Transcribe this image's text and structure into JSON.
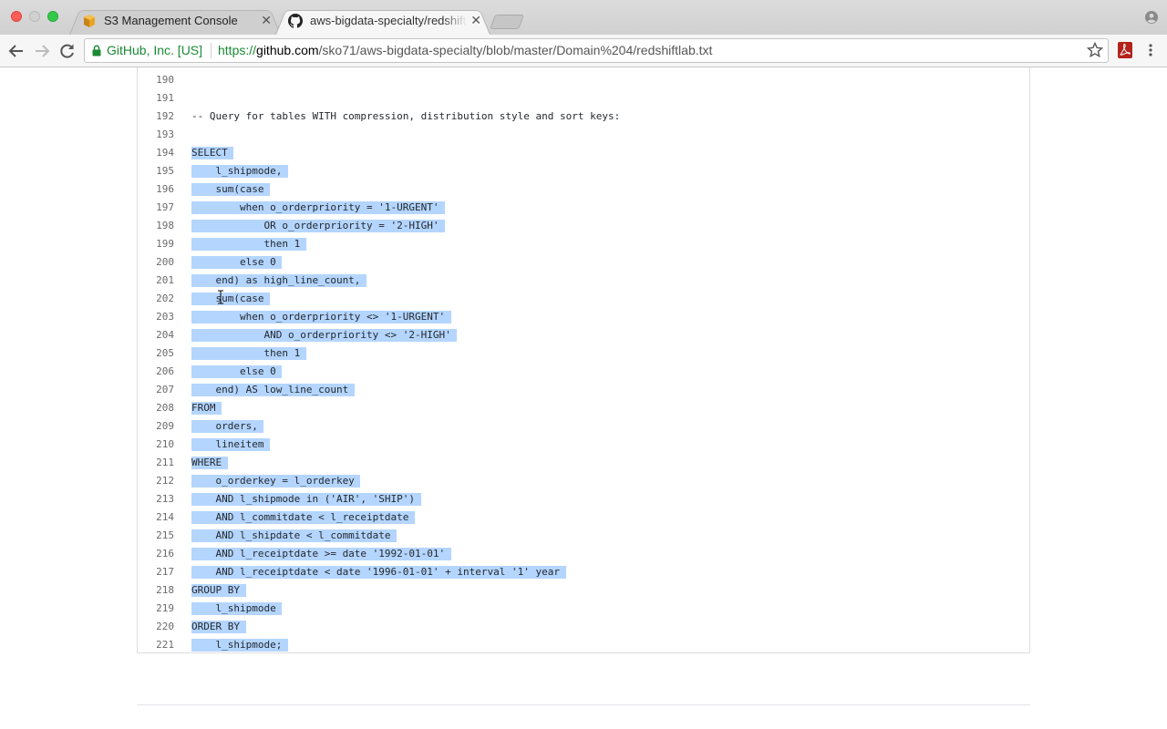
{
  "browser": {
    "tabs": [
      {
        "title": "S3 Management Console",
        "icon": "aws-s3-icon",
        "active": false
      },
      {
        "title": "aws-bigdata-specialty/redshiftlab.txt",
        "icon": "github-icon",
        "active": true
      }
    ],
    "address_bar": {
      "ev_label": "GitHub, Inc. [US]",
      "url_scheme": "https://",
      "url_host": "github.com",
      "url_path": "/sko71/aws-bigdata-specialty/blob/master/Domain%204/redshiftlab.txt"
    }
  },
  "code": {
    "lines": [
      {
        "num": "190",
        "text": "",
        "selected": false
      },
      {
        "num": "191",
        "text": "",
        "selected": false
      },
      {
        "num": "192",
        "text": "-- Query for tables WITH compression, distribution style and sort keys:",
        "selected": false
      },
      {
        "num": "193",
        "text": "",
        "selected": false
      },
      {
        "num": "194",
        "text": "SELECT ",
        "selected": true
      },
      {
        "num": "195",
        "text": "    l_shipmode, ",
        "selected": true
      },
      {
        "num": "196",
        "text": "    sum(case ",
        "selected": true
      },
      {
        "num": "197",
        "text": "        when o_orderpriority = '1-URGENT' ",
        "selected": true
      },
      {
        "num": "198",
        "text": "            OR o_orderpriority = '2-HIGH' ",
        "selected": true
      },
      {
        "num": "199",
        "text": "            then 1 ",
        "selected": true
      },
      {
        "num": "200",
        "text": "        else 0 ",
        "selected": true
      },
      {
        "num": "201",
        "text": "    end) as high_line_count, ",
        "selected": true
      },
      {
        "num": "202",
        "text": "    sum(case ",
        "selected": true
      },
      {
        "num": "203",
        "text": "        when o_orderpriority <> '1-URGENT' ",
        "selected": true
      },
      {
        "num": "204",
        "text": "            AND o_orderpriority <> '2-HIGH' ",
        "selected": true
      },
      {
        "num": "205",
        "text": "            then 1 ",
        "selected": true
      },
      {
        "num": "206",
        "text": "        else 0 ",
        "selected": true
      },
      {
        "num": "207",
        "text": "    end) AS low_line_count ",
        "selected": true
      },
      {
        "num": "208",
        "text": "FROM ",
        "selected": true
      },
      {
        "num": "209",
        "text": "    orders, ",
        "selected": true
      },
      {
        "num": "210",
        "text": "    lineitem ",
        "selected": true
      },
      {
        "num": "211",
        "text": "WHERE ",
        "selected": true
      },
      {
        "num": "212",
        "text": "    o_orderkey = l_orderkey ",
        "selected": true
      },
      {
        "num": "213",
        "text": "    AND l_shipmode in ('AIR', 'SHIP') ",
        "selected": true
      },
      {
        "num": "214",
        "text": "    AND l_commitdate < l_receiptdate ",
        "selected": true
      },
      {
        "num": "215",
        "text": "    AND l_shipdate < l_commitdate ",
        "selected": true
      },
      {
        "num": "216",
        "text": "    AND l_receiptdate >= date '1992-01-01' ",
        "selected": true
      },
      {
        "num": "217",
        "text": "    AND l_receiptdate < date '1996-01-01' + interval '1' year ",
        "selected": true
      },
      {
        "num": "218",
        "text": "GROUP BY ",
        "selected": true
      },
      {
        "num": "219",
        "text": "    l_shipmode ",
        "selected": true
      },
      {
        "num": "220",
        "text": "ORDER BY ",
        "selected": true
      },
      {
        "num": "221",
        "text": "    l_shipmode; ",
        "selected": true
      }
    ]
  },
  "colors": {
    "selection": "#b4d5fe",
    "ev_green": "#1a8a34"
  }
}
